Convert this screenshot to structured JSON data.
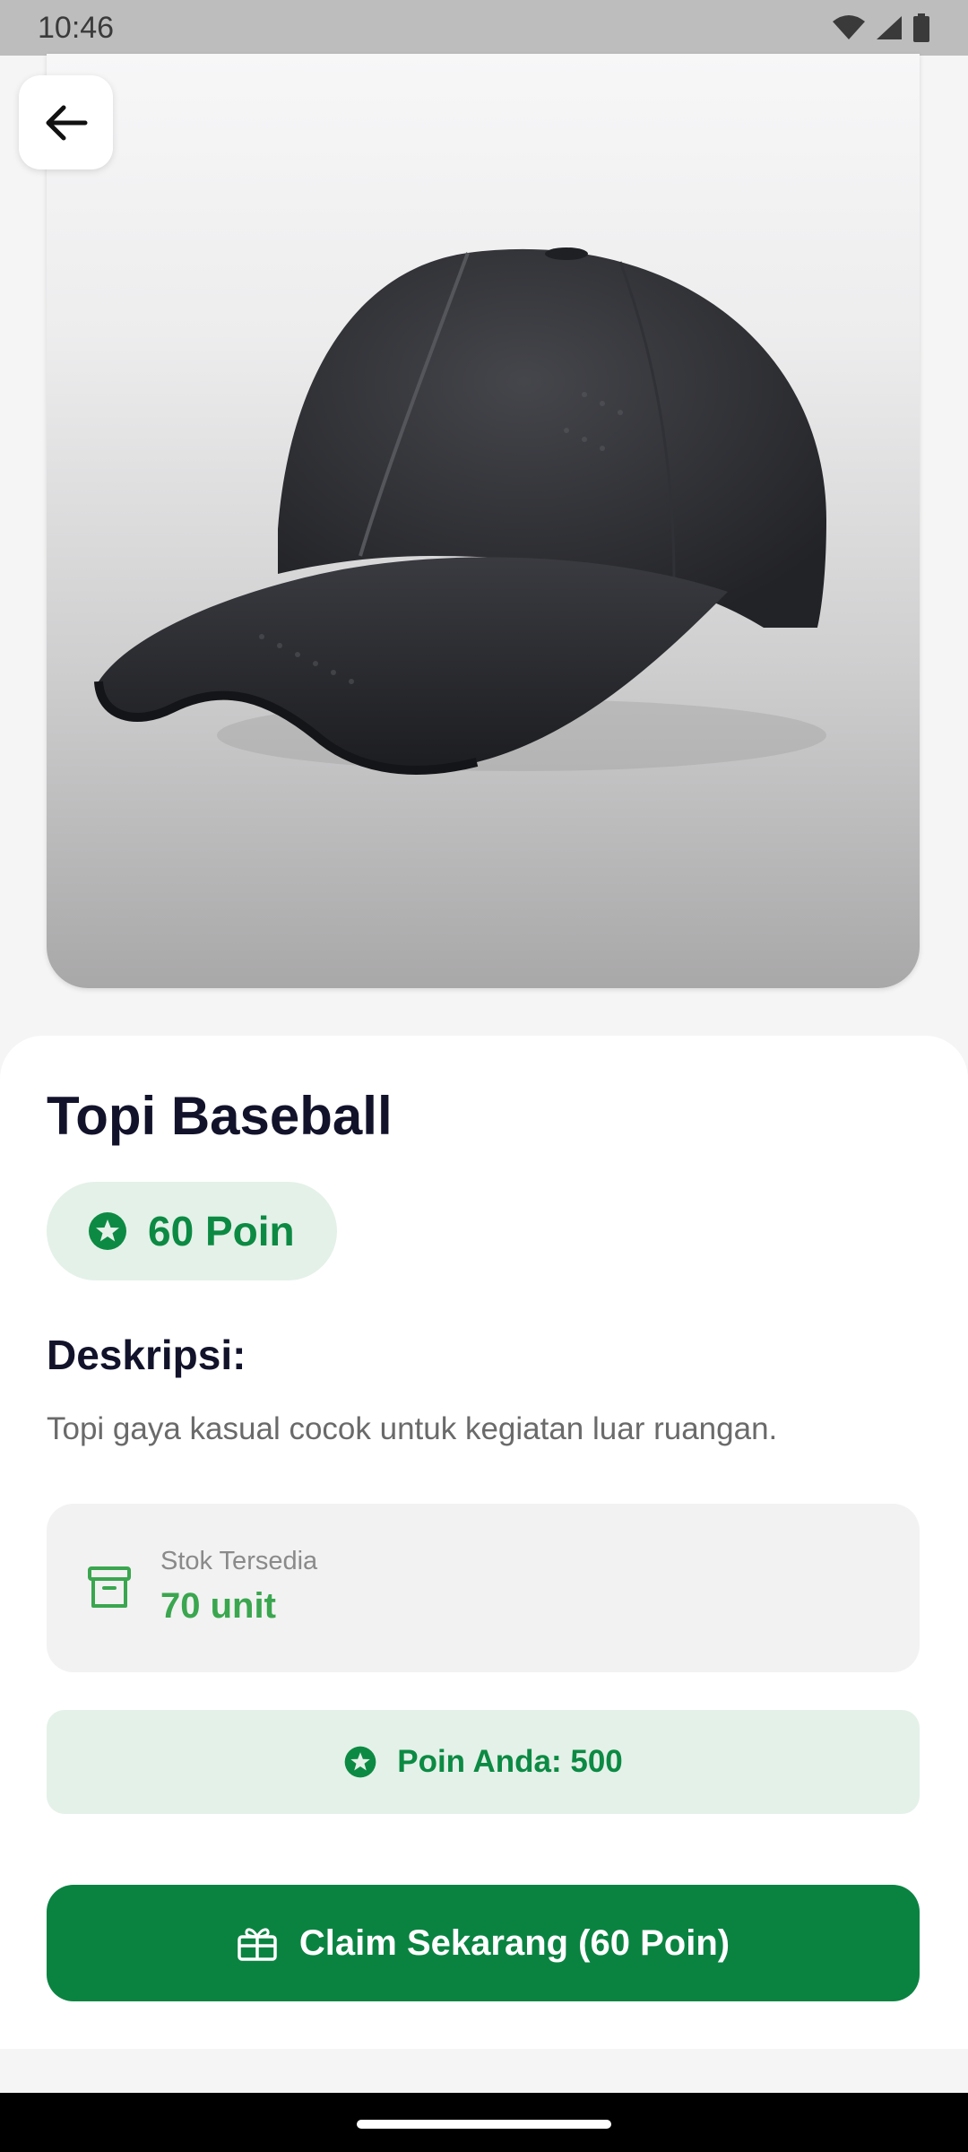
{
  "status_bar": {
    "time": "10:46",
    "icons": [
      "wifi-icon",
      "signal-icon",
      "battery-icon"
    ]
  },
  "product": {
    "image": "baseball-cap-image",
    "title": "Topi Baseball",
    "points_label": "60 Poin",
    "description_heading": "Deskripsi:",
    "description": "Topi gaya kasual cocok untuk kegiatan luar ruangan.",
    "stock_label": "Stok Tersedia",
    "stock_value": "70 unit"
  },
  "user": {
    "points_text": "Poin Anda: 500"
  },
  "actions": {
    "back": "arrow-back-icon",
    "claim_label": "Claim Sekarang (60 Poin)"
  },
  "colors": {
    "primary": "#0a8341",
    "chip_bg": "#e4f1e8",
    "stock_green": "#3aa64f",
    "title": "#12132b"
  }
}
